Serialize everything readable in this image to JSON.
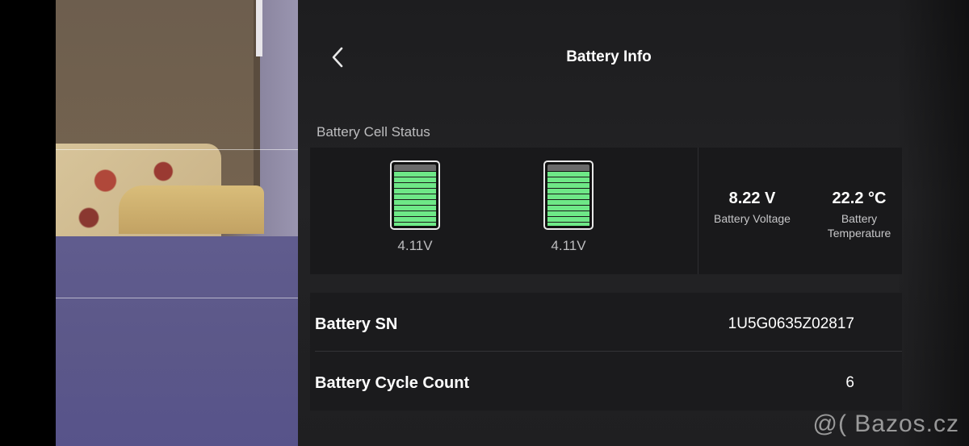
{
  "header": {
    "title": "Battery Info"
  },
  "cell_status": {
    "label": "Battery Cell Status",
    "cells": [
      {
        "voltage": "4.11V",
        "level": 1.0
      },
      {
        "voltage": "4.11V",
        "level": 1.0
      }
    ],
    "battery_voltage": {
      "value": "8.22 V",
      "label": "Battery Voltage"
    },
    "battery_temperature": {
      "value": "22.2 °C",
      "label": "Battery Temperature"
    },
    "cell_color": "#6ee887"
  },
  "info": {
    "rows": [
      {
        "key": "Battery SN",
        "value": "1U5G0635Z02817"
      },
      {
        "key": "Battery Cycle Count",
        "value": "6"
      }
    ]
  },
  "watermark": "@( Bazos.cz",
  "icons": {
    "back": "chevron-left-icon",
    "battery": "battery-icon"
  }
}
